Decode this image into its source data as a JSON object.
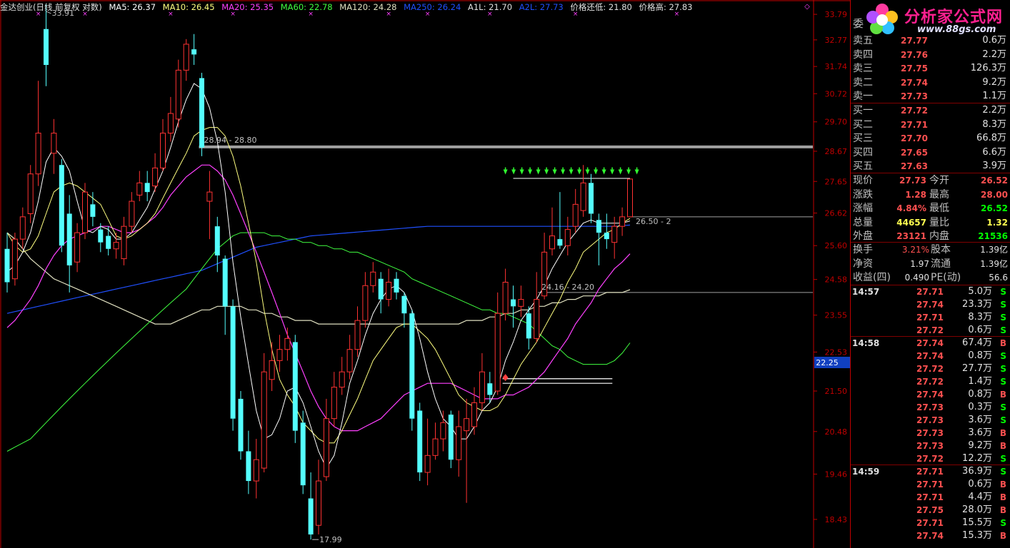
{
  "header": {
    "title": "金达创业(日线 前复权 对数)",
    "ma5": "MA5: 26.37",
    "ma10": "MA10: 26.45",
    "ma20": "MA20: 25.35",
    "ma60": "MA60: 22.78",
    "ma120": "MA120: 24.28",
    "ma250": "MA250: 26.24",
    "a1l": "A1L: 21.70",
    "a2l": "A2L: 27.73",
    "price_low": "价格还低: 21.80",
    "price_high": "价格高: 27.83"
  },
  "colors": {
    "up": "#ff3232",
    "down": "#54ffff",
    "ma5": "#ffffff",
    "ma10": "#ffff80",
    "ma20": "#ff40ff",
    "ma60": "#40ff40",
    "ma120": "#e0e0c0",
    "ma250": "#2050ff",
    "axis": "#c00000"
  },
  "price_axis": [
    "33.79",
    "32.77",
    "31.74",
    "30.72",
    "29.70",
    "28.67",
    "27.65",
    "26.62",
    "25.60",
    "24.58",
    "23.55",
    "22.53",
    "21.50",
    "20.48",
    "19.46",
    "18.43"
  ],
  "price_axis_current": "22.25",
  "annotations": {
    "high_label": "33.91",
    "low_label": "17.99",
    "band1": "28.94 - 28.80",
    "band2": "24.16 - 24.20",
    "band3": "26.50 - 2"
  },
  "logo": {
    "title": "分析家公式网",
    "url": "www.88gs.com"
  },
  "order_book": {
    "header_label": "委",
    "asks": [
      {
        "label": "卖五",
        "price": "27.77",
        "vol": "0.6万"
      },
      {
        "label": "卖四",
        "price": "27.76",
        "vol": "2.2万"
      },
      {
        "label": "卖三",
        "price": "27.75",
        "vol": "126.3万"
      },
      {
        "label": "卖二",
        "price": "27.74",
        "vol": "9.2万"
      },
      {
        "label": "卖一",
        "price": "27.73",
        "vol": "1.1万"
      }
    ],
    "bids": [
      {
        "label": "买一",
        "price": "27.72",
        "vol": "2.2万"
      },
      {
        "label": "买二",
        "price": "27.71",
        "vol": "8.3万"
      },
      {
        "label": "买三",
        "price": "27.70",
        "vol": "66.8万"
      },
      {
        "label": "买四",
        "price": "27.65",
        "vol": "6.6万"
      },
      {
        "label": "买五",
        "price": "27.63",
        "vol": "3.9万"
      }
    ]
  },
  "quote": [
    {
      "l1": "现价",
      "v1": "27.73",
      "l2": "今开",
      "v2": "26.52"
    },
    {
      "l1": "涨跌",
      "v1": "1.28",
      "l2": "最高",
      "v2": "28.00"
    },
    {
      "l1": "涨幅",
      "v1": "4.84%",
      "l2": "最低",
      "v2": "26.52"
    },
    {
      "l1": "总量",
      "v1": "44657",
      "l2": "量比",
      "v2": "1.32"
    },
    {
      "l1": "外盘",
      "v1": "23121",
      "l2": "内盘",
      "v2": "21536"
    }
  ],
  "fundamentals": [
    {
      "l1": "换手",
      "v1": "3.21%",
      "l2": "股本",
      "v2": "1.39亿"
    },
    {
      "l1": "净资",
      "v1": "1.97",
      "l2": "流通",
      "v2": "1.39亿"
    },
    {
      "l1": "收益(四)",
      "v1": "0.490",
      "l2": "PE(动)",
      "v2": "56.6"
    }
  ],
  "ticks": [
    {
      "time": "14:57",
      "price": "27.71",
      "vol": "5.0万",
      "side": "S"
    },
    {
      "time": "",
      "price": "27.74",
      "vol": "23.3万",
      "side": "S"
    },
    {
      "time": "",
      "price": "27.71",
      "vol": "8.3万",
      "side": "S"
    },
    {
      "time": "",
      "price": "27.72",
      "vol": "0.6万",
      "side": "S"
    },
    {
      "time": "14:58",
      "price": "27.74",
      "vol": "67.4万",
      "side": "B"
    },
    {
      "time": "",
      "price": "27.74",
      "vol": "0.8万",
      "side": "S"
    },
    {
      "time": "",
      "price": "27.72",
      "vol": "27.7万",
      "side": "S"
    },
    {
      "time": "",
      "price": "27.72",
      "vol": "1.4万",
      "side": "S"
    },
    {
      "time": "",
      "price": "27.74",
      "vol": "0.8万",
      "side": "B"
    },
    {
      "time": "",
      "price": "27.73",
      "vol": "0.3万",
      "side": "S"
    },
    {
      "time": "",
      "price": "27.73",
      "vol": "3.6万",
      "side": "S"
    },
    {
      "time": "",
      "price": "27.73",
      "vol": "3.6万",
      "side": "B"
    },
    {
      "time": "",
      "price": "27.73",
      "vol": "9.2万",
      "side": "B"
    },
    {
      "time": "",
      "price": "27.72",
      "vol": "12.2万",
      "side": "S"
    },
    {
      "time": "14:59",
      "price": "27.71",
      "vol": "36.9万",
      "side": "S"
    },
    {
      "time": "",
      "price": "27.71",
      "vol": "0.6万",
      "side": "B"
    },
    {
      "time": "",
      "price": "27.71",
      "vol": "4.4万",
      "side": "B"
    },
    {
      "time": "",
      "price": "27.75",
      "vol": "28.0万",
      "side": "B"
    },
    {
      "time": "",
      "price": "27.71",
      "vol": "15.5万",
      "side": "S"
    },
    {
      "time": "",
      "price": "27.74",
      "vol": "15.3万",
      "side": "B"
    }
  ],
  "chart_data": {
    "type": "candlestick",
    "scale": "log",
    "ylim": [
      17.9,
      34.2
    ],
    "candles": [
      [
        25.5,
        24.5,
        26.0,
        24.2
      ],
      [
        24.6,
        25.8,
        26.0,
        24.4
      ],
      [
        25.8,
        26.5,
        26.8,
        25.5
      ],
      [
        26.6,
        27.9,
        28.2,
        26.3
      ],
      [
        27.9,
        29.3,
        31.2,
        27.5
      ],
      [
        33.2,
        31.8,
        34.2,
        31.0
      ],
      [
        28.6,
        29.3,
        29.8,
        27.9
      ],
      [
        28.2,
        25.6,
        28.4,
        25.4
      ],
      [
        26.6,
        25.0,
        27.2,
        24.2
      ],
      [
        25.1,
        26.0,
        26.3,
        24.8
      ],
      [
        26.0,
        27.3,
        27.6,
        25.8
      ],
      [
        26.9,
        26.5,
        27.3,
        26.2
      ],
      [
        26.1,
        25.7,
        26.3,
        25.4
      ],
      [
        25.9,
        25.5,
        26.2,
        25.3
      ],
      [
        25.5,
        25.7,
        26.0,
        25.2
      ],
      [
        25.2,
        26.2,
        26.5,
        25.0
      ],
      [
        26.2,
        27.0,
        27.3,
        26.0
      ],
      [
        27.2,
        27.6,
        28.0,
        27.0
      ],
      [
        27.6,
        27.3,
        28.0,
        27.0
      ],
      [
        27.5,
        28.1,
        28.6,
        27.3
      ],
      [
        28.1,
        29.3,
        29.8,
        28.0
      ],
      [
        29.3,
        30.0,
        30.6,
        29.0
      ],
      [
        29.8,
        31.6,
        32.0,
        29.5
      ],
      [
        31.6,
        32.6,
        32.8,
        31.2
      ],
      [
        32.4,
        32.2,
        33.0,
        31.8
      ],
      [
        31.3,
        28.8,
        31.5,
        28.5
      ],
      [
        27.0,
        27.3,
        28.0,
        25.8
      ],
      [
        26.2,
        25.3,
        26.5,
        24.8
      ],
      [
        25.2,
        23.8,
        25.3,
        23.0
      ],
      [
        23.8,
        20.8,
        24.0,
        20.5
      ],
      [
        21.3,
        20.0,
        21.5,
        19.8
      ],
      [
        20.0,
        19.3,
        20.5,
        19.0
      ],
      [
        19.3,
        19.8,
        20.3,
        18.9
      ],
      [
        19.6,
        22.0,
        22.5,
        19.5
      ],
      [
        21.8,
        22.3,
        22.8,
        21.5
      ],
      [
        22.3,
        22.6,
        23.0,
        22.0
      ],
      [
        22.6,
        22.9,
        23.2,
        22.3
      ],
      [
        22.8,
        20.5,
        23.0,
        20.2
      ],
      [
        20.7,
        19.2,
        21.0,
        19.0
      ],
      [
        18.9,
        18.1,
        19.5,
        17.99
      ],
      [
        18.3,
        19.3,
        19.8,
        18.1
      ],
      [
        19.4,
        20.8,
        21.3,
        19.3
      ],
      [
        20.8,
        21.6,
        22.0,
        20.6
      ],
      [
        21.6,
        22.0,
        22.4,
        21.4
      ],
      [
        22.0,
        22.6,
        23.0,
        21.8
      ],
      [
        22.6,
        23.4,
        23.8,
        22.4
      ],
      [
        23.4,
        24.4,
        24.8,
        23.2
      ],
      [
        24.4,
        24.8,
        25.1,
        24.2
      ],
      [
        24.6,
        24.0,
        24.8,
        23.6
      ],
      [
        24.0,
        24.5,
        24.9,
        23.8
      ],
      [
        24.6,
        24.2,
        24.8,
        24.0
      ],
      [
        24.1,
        23.6,
        24.2,
        23.2
      ],
      [
        23.6,
        20.8,
        23.7,
        20.5
      ],
      [
        21.0,
        19.5,
        21.2,
        19.3
      ],
      [
        19.5,
        19.9,
        20.8,
        19.2
      ],
      [
        19.9,
        20.3,
        20.7,
        19.8
      ],
      [
        20.3,
        20.7,
        21.0,
        20.0
      ],
      [
        20.9,
        19.8,
        21.0,
        19.6
      ],
      [
        19.8,
        20.6,
        21.0,
        19.4
      ],
      [
        20.5,
        20.8,
        21.3,
        18.8
      ],
      [
        20.6,
        21.2,
        21.6,
        20.4
      ],
      [
        21.2,
        22.0,
        22.5,
        21.0
      ],
      [
        21.7,
        21.4,
        22.0,
        21.2
      ],
      [
        21.5,
        23.6,
        24.2,
        21.4
      ],
      [
        23.6,
        24.5,
        24.9,
        23.4
      ],
      [
        24.0,
        23.8,
        24.4,
        23.2
      ],
      [
        23.8,
        24.0,
        24.4,
        23.5
      ],
      [
        23.6,
        22.9,
        23.8,
        22.6
      ],
      [
        22.9,
        24.0,
        24.8,
        22.8
      ],
      [
        24.1,
        25.4,
        26.0,
        24.0
      ],
      [
        25.5,
        25.9,
        26.8,
        25.3
      ],
      [
        25.8,
        25.6,
        27.3,
        25.5
      ],
      [
        25.6,
        26.1,
        26.5,
        25.3
      ],
      [
        26.2,
        26.9,
        27.4,
        26.0
      ],
      [
        26.7,
        27.6,
        28.2,
        26.5
      ],
      [
        27.6,
        26.6,
        27.9,
        26.3
      ],
      [
        26.4,
        26.0,
        26.6,
        25.0
      ],
      [
        26.0,
        25.8,
        26.6,
        25.5
      ],
      [
        25.7,
        26.2,
        26.5,
        25.2
      ],
      [
        26.2,
        26.5,
        26.8,
        25.9
      ],
      [
        26.5,
        27.73,
        27.73,
        26.52
      ]
    ],
    "ma5": [
      24.8,
      25.0,
      25.4,
      26.0,
      27.0,
      28.3,
      28.8,
      28.5,
      28.0,
      27.0,
      26.1,
      26.0,
      26.2,
      26.1,
      25.8,
      25.8,
      26.0,
      26.4,
      26.8,
      27.4,
      28.0,
      28.8,
      29.7,
      30.5,
      31.1,
      30.9,
      30.2,
      29.0,
      27.3,
      25.1,
      23.5,
      22.2,
      21.0,
      20.3,
      20.4,
      20.8,
      21.5,
      21.6,
      21.2,
      20.6,
      20.0,
      19.6,
      19.9,
      20.7,
      21.7,
      22.3,
      23.0,
      23.6,
      24.0,
      24.3,
      24.4,
      24.2,
      23.7,
      22.9,
      22.0,
      21.3,
      20.8,
      20.6,
      20.3,
      20.3,
      20.6,
      21.0,
      21.2,
      21.6,
      22.3,
      22.8,
      23.4,
      23.7,
      24.0,
      24.4,
      24.9,
      25.3,
      25.7,
      26.0,
      26.3,
      26.4,
      26.3,
      26.3,
      26.3,
      26.3,
      26.37
    ],
    "ma10": [
      26.0,
      25.6,
      25.4,
      25.5,
      25.9,
      26.6,
      27.3,
      27.5,
      27.6,
      27.5,
      27.3,
      27.1,
      26.9,
      26.4,
      25.9,
      25.8,
      25.9,
      26.1,
      26.3,
      26.6,
      27.1,
      27.6,
      28.1,
      28.6,
      29.2,
      29.4,
      29.5,
      29.5,
      29.2,
      28.5,
      27.5,
      26.3,
      25.1,
      23.7,
      22.6,
      21.8,
      21.4,
      21.1,
      20.7,
      20.5,
      20.3,
      20.2,
      20.2,
      20.5,
      20.9,
      21.3,
      21.8,
      22.3,
      22.6,
      22.9,
      23.2,
      23.3,
      23.3,
      23.1,
      22.9,
      22.6,
      22.2,
      21.8,
      21.4,
      21.2,
      21.1,
      21.0,
      21.0,
      21.1,
      21.4,
      21.8,
      22.2,
      22.5,
      22.8,
      23.2,
      23.6,
      24.0,
      24.5,
      24.9,
      25.4,
      25.6,
      25.8,
      26.0,
      26.1,
      26.3,
      26.45
    ],
    "ma20": [
      23.2,
      23.4,
      23.7,
      24.0,
      24.4,
      24.9,
      25.3,
      25.6,
      25.8,
      25.9,
      26.0,
      26.1,
      26.2,
      26.2,
      26.1,
      26.0,
      26.0,
      26.1,
      26.3,
      26.5,
      26.8,
      27.2,
      27.5,
      27.8,
      28.0,
      28.2,
      28.2,
      28.0,
      27.7,
      27.2,
      26.6,
      26.0,
      25.4,
      24.8,
      24.2,
      23.6,
      23.0,
      22.5,
      22.0,
      21.5,
      21.1,
      20.8,
      20.6,
      20.5,
      20.5,
      20.5,
      20.6,
      20.7,
      20.8,
      21.0,
      21.2,
      21.4,
      21.5,
      21.6,
      21.7,
      21.7,
      21.7,
      21.7,
      21.6,
      21.5,
      21.4,
      21.3,
      21.3,
      21.3,
      21.4,
      21.4,
      21.5,
      21.6,
      21.8,
      22.0,
      22.3,
      22.6,
      22.9,
      23.3,
      23.6,
      23.9,
      24.3,
      24.6,
      24.9,
      25.1,
      25.35
    ],
    "ma60": [
      20.0,
      20.1,
      20.2,
      20.3,
      20.5,
      20.7,
      20.9,
      21.1,
      21.3,
      21.5,
      21.7,
      21.9,
      22.1,
      22.3,
      22.5,
      22.7,
      22.9,
      23.1,
      23.3,
      23.5,
      23.7,
      23.9,
      24.1,
      24.3,
      24.6,
      24.9,
      25.2,
      25.5,
      25.7,
      25.9,
      26.0,
      26.0,
      26.0,
      26.0,
      25.9,
      25.9,
      25.8,
      25.8,
      25.7,
      25.7,
      25.6,
      25.6,
      25.5,
      25.5,
      25.4,
      25.4,
      25.3,
      25.2,
      25.1,
      25.0,
      24.9,
      24.8,
      24.6,
      24.5,
      24.4,
      24.3,
      24.2,
      24.1,
      24.0,
      23.9,
      23.8,
      23.7,
      23.7,
      23.6,
      23.6,
      23.5,
      23.4,
      23.3,
      23.1,
      22.9,
      22.7,
      22.6,
      22.4,
      22.3,
      22.2,
      22.2,
      22.2,
      22.2,
      22.3,
      22.5,
      22.78
    ],
    "ma120": [
      26.0,
      25.8,
      25.5,
      25.2,
      25.0,
      24.8,
      24.6,
      24.5,
      24.4,
      24.3,
      24.2,
      24.1,
      24.0,
      23.9,
      23.8,
      23.7,
      23.6,
      23.5,
      23.4,
      23.3,
      23.3,
      23.3,
      23.4,
      23.5,
      23.6,
      23.7,
      23.7,
      23.8,
      23.8,
      23.8,
      23.8,
      23.7,
      23.7,
      23.6,
      23.6,
      23.5,
      23.5,
      23.4,
      23.4,
      23.4,
      23.3,
      23.3,
      23.3,
      23.3,
      23.3,
      23.3,
      23.3,
      23.3,
      23.3,
      23.3,
      23.3,
      23.3,
      23.3,
      23.3,
      23.3,
      23.3,
      23.3,
      23.3,
      23.3,
      23.4,
      23.4,
      23.4,
      23.5,
      23.5,
      23.6,
      23.6,
      23.7,
      23.7,
      23.8,
      23.8,
      23.9,
      23.9,
      24.0,
      24.0,
      24.1,
      24.1,
      24.1,
      24.2,
      24.2,
      24.2,
      24.28
    ],
    "ma250": [
      23.6,
      23.65,
      23.7,
      23.75,
      23.8,
      23.85,
      23.9,
      23.95,
      24.0,
      24.05,
      24.1,
      24.15,
      24.2,
      24.25,
      24.3,
      24.35,
      24.4,
      24.45,
      24.5,
      24.55,
      24.6,
      24.65,
      24.7,
      24.75,
      24.8,
      24.85,
      24.95,
      25.05,
      25.15,
      25.25,
      25.35,
      25.45,
      25.55,
      25.6,
      25.65,
      25.7,
      25.75,
      25.8,
      25.85,
      25.9,
      25.92,
      25.94,
      25.96,
      25.98,
      26.0,
      26.02,
      26.04,
      26.06,
      26.08,
      26.1,
      26.12,
      26.14,
      26.16,
      26.18,
      26.2,
      26.2,
      26.2,
      26.2,
      26.2,
      26.2,
      26.2,
      26.2,
      26.2,
      26.2,
      26.2,
      26.2,
      26.2,
      26.2,
      26.2,
      26.2,
      26.2,
      26.2,
      26.2,
      26.2,
      26.2,
      26.2,
      26.2,
      26.2,
      26.2,
      26.22,
      26.24
    ]
  }
}
